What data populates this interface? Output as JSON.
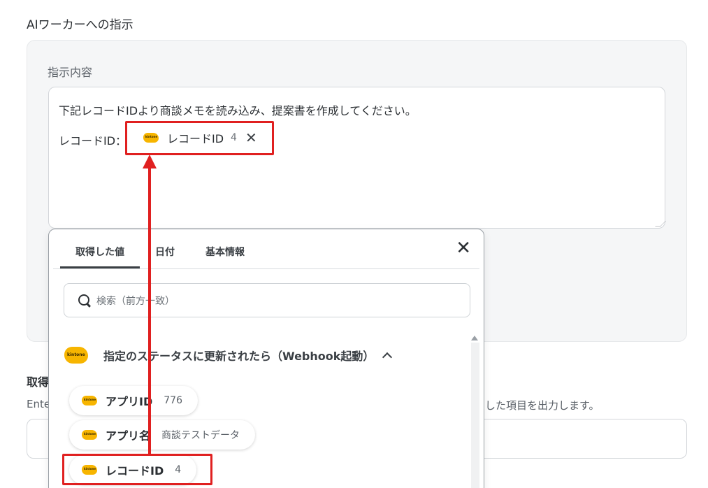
{
  "section": {
    "title": "AIワーカーへの指示"
  },
  "instruction": {
    "label": "指示内容",
    "line1": "下記レコードIDより商談メモを読み込み、提案書を作成してください。",
    "line2_label": "レコードID：",
    "chip": {
      "label": "レコードID",
      "count": "4",
      "close": "✕",
      "icon": "kintone"
    }
  },
  "background": {
    "label2": "取得",
    "desc_left": "Ente",
    "desc_right": "した項目を出力します。"
  },
  "popup": {
    "tabs": [
      {
        "label": "取得した値",
        "active": true
      },
      {
        "label": "日付",
        "active": false
      },
      {
        "label": "基本情報",
        "active": false
      }
    ],
    "close": "✕",
    "search_placeholder": "検索（前方一致）",
    "group": {
      "title": "指定のステータスに更新されたら（Webhook起動）",
      "icon": "kintone",
      "expanded": true
    },
    "items": [
      {
        "name": "アプリID",
        "value": "776",
        "icon": "kintone"
      },
      {
        "name": "アプリ名",
        "value": "商談テストデータ",
        "icon": "kintone"
      },
      {
        "name": "レコードID",
        "value": "4",
        "icon": "kintone"
      }
    ]
  },
  "annotation": {
    "color": "#e02020"
  },
  "icon_text": "kintone"
}
